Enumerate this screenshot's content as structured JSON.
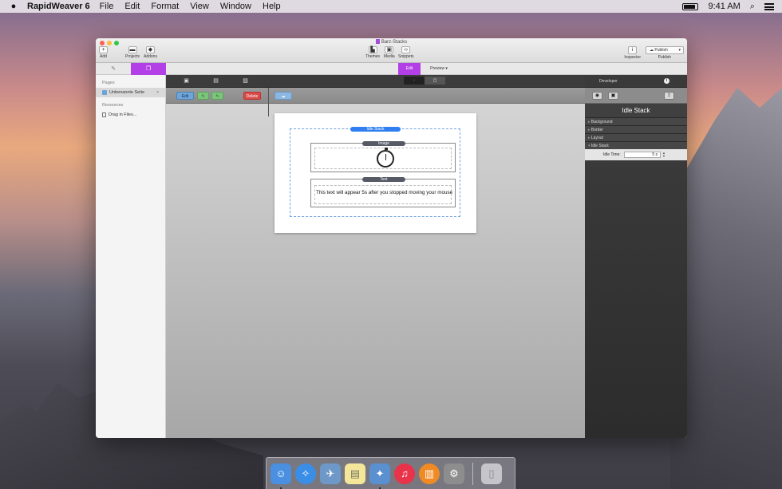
{
  "menubar": {
    "app_name": "RapidWeaver 6",
    "items": [
      "File",
      "Edit",
      "Format",
      "View",
      "Window",
      "Help"
    ],
    "clock": "9:41 AM"
  },
  "window": {
    "title": "Barz-Stacks",
    "toolbar": {
      "add": "Add",
      "projects": "Projects",
      "addons": "Addons",
      "themes": "Themes",
      "media": "Media",
      "snippets": "Snippets",
      "inspector": "Inspector",
      "publish": "Publish",
      "publish_button": "Publish"
    },
    "modes": {
      "edit": "Edit",
      "preview": "Preview"
    }
  },
  "sidebar": {
    "pages_header": "Pages",
    "page_item": "Unbenannte Seite",
    "resources_header": "Resources",
    "resources_item": "Drag in Files..."
  },
  "editor": {
    "buttons": {
      "edit": "Edit",
      "delete": "Delete"
    },
    "stack_label": "Idle Stack",
    "image_label": "Image",
    "text_label": "Text",
    "text_content": "This text will appear 5s after you stopped moving your mouse"
  },
  "inspector": {
    "header": "Developer",
    "title": "Idle Stack",
    "sections": [
      "Background",
      "Border",
      "Layout",
      "Idle Stack"
    ],
    "idle_time_label": "Idle Time:",
    "idle_time_value": "5 s"
  },
  "colors": {
    "accent": "#b340e6",
    "stack_blue": "#2f7ff0"
  }
}
